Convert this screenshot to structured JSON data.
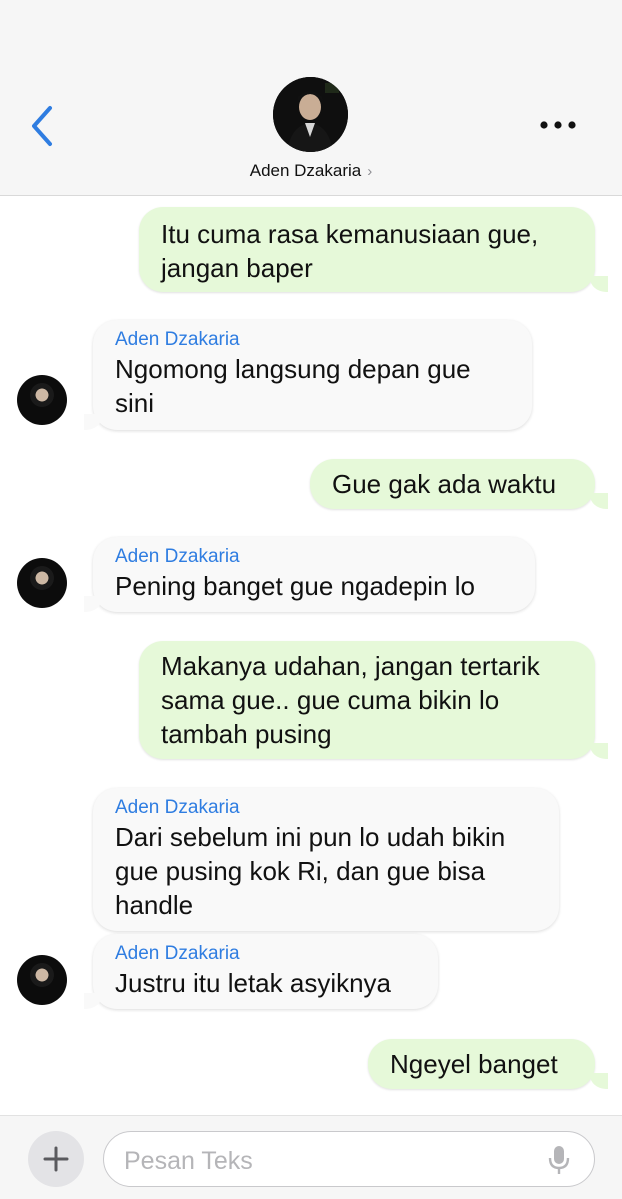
{
  "header": {
    "contact_name": "Aden Dzakaria",
    "chevron": "›",
    "back_icon": "chevron-left-icon",
    "more_icon": "ellipsis-icon"
  },
  "messages": [
    {
      "from": "me",
      "text": "Itu cuma rasa kemanusiaan gue, jangan baper"
    },
    {
      "from": "them",
      "sender": "Aden Dzakaria",
      "text": "Ngomong langsung depan gue sini"
    },
    {
      "from": "me",
      "text": "Gue gak ada waktu"
    },
    {
      "from": "them",
      "sender": "Aden Dzakaria",
      "text": "Pening banget gue ngadepin lo"
    },
    {
      "from": "me",
      "text": "Makanya udahan, jangan tertarik sama gue.. gue cuma bikin lo tambah pusing"
    },
    {
      "from": "them",
      "sender": "Aden Dzakaria",
      "text": "Dari sebelum ini pun lo udah bikin gue pusing kok Ri, dan gue bisa handle"
    },
    {
      "from": "them",
      "sender": "Aden Dzakaria",
      "text": "Justru itu letak asyiknya"
    },
    {
      "from": "me",
      "text": "Ngeyel banget"
    }
  ],
  "composer": {
    "placeholder": "Pesan Teks",
    "value": "",
    "plus_icon": "plus-icon",
    "mic_icon": "microphone-icon"
  },
  "colors": {
    "outgoing_bubble": "#e6f9d9",
    "incoming_bubble": "#f9f9f9",
    "sender_name": "#2f7de1",
    "accent": "#2f7de1"
  }
}
